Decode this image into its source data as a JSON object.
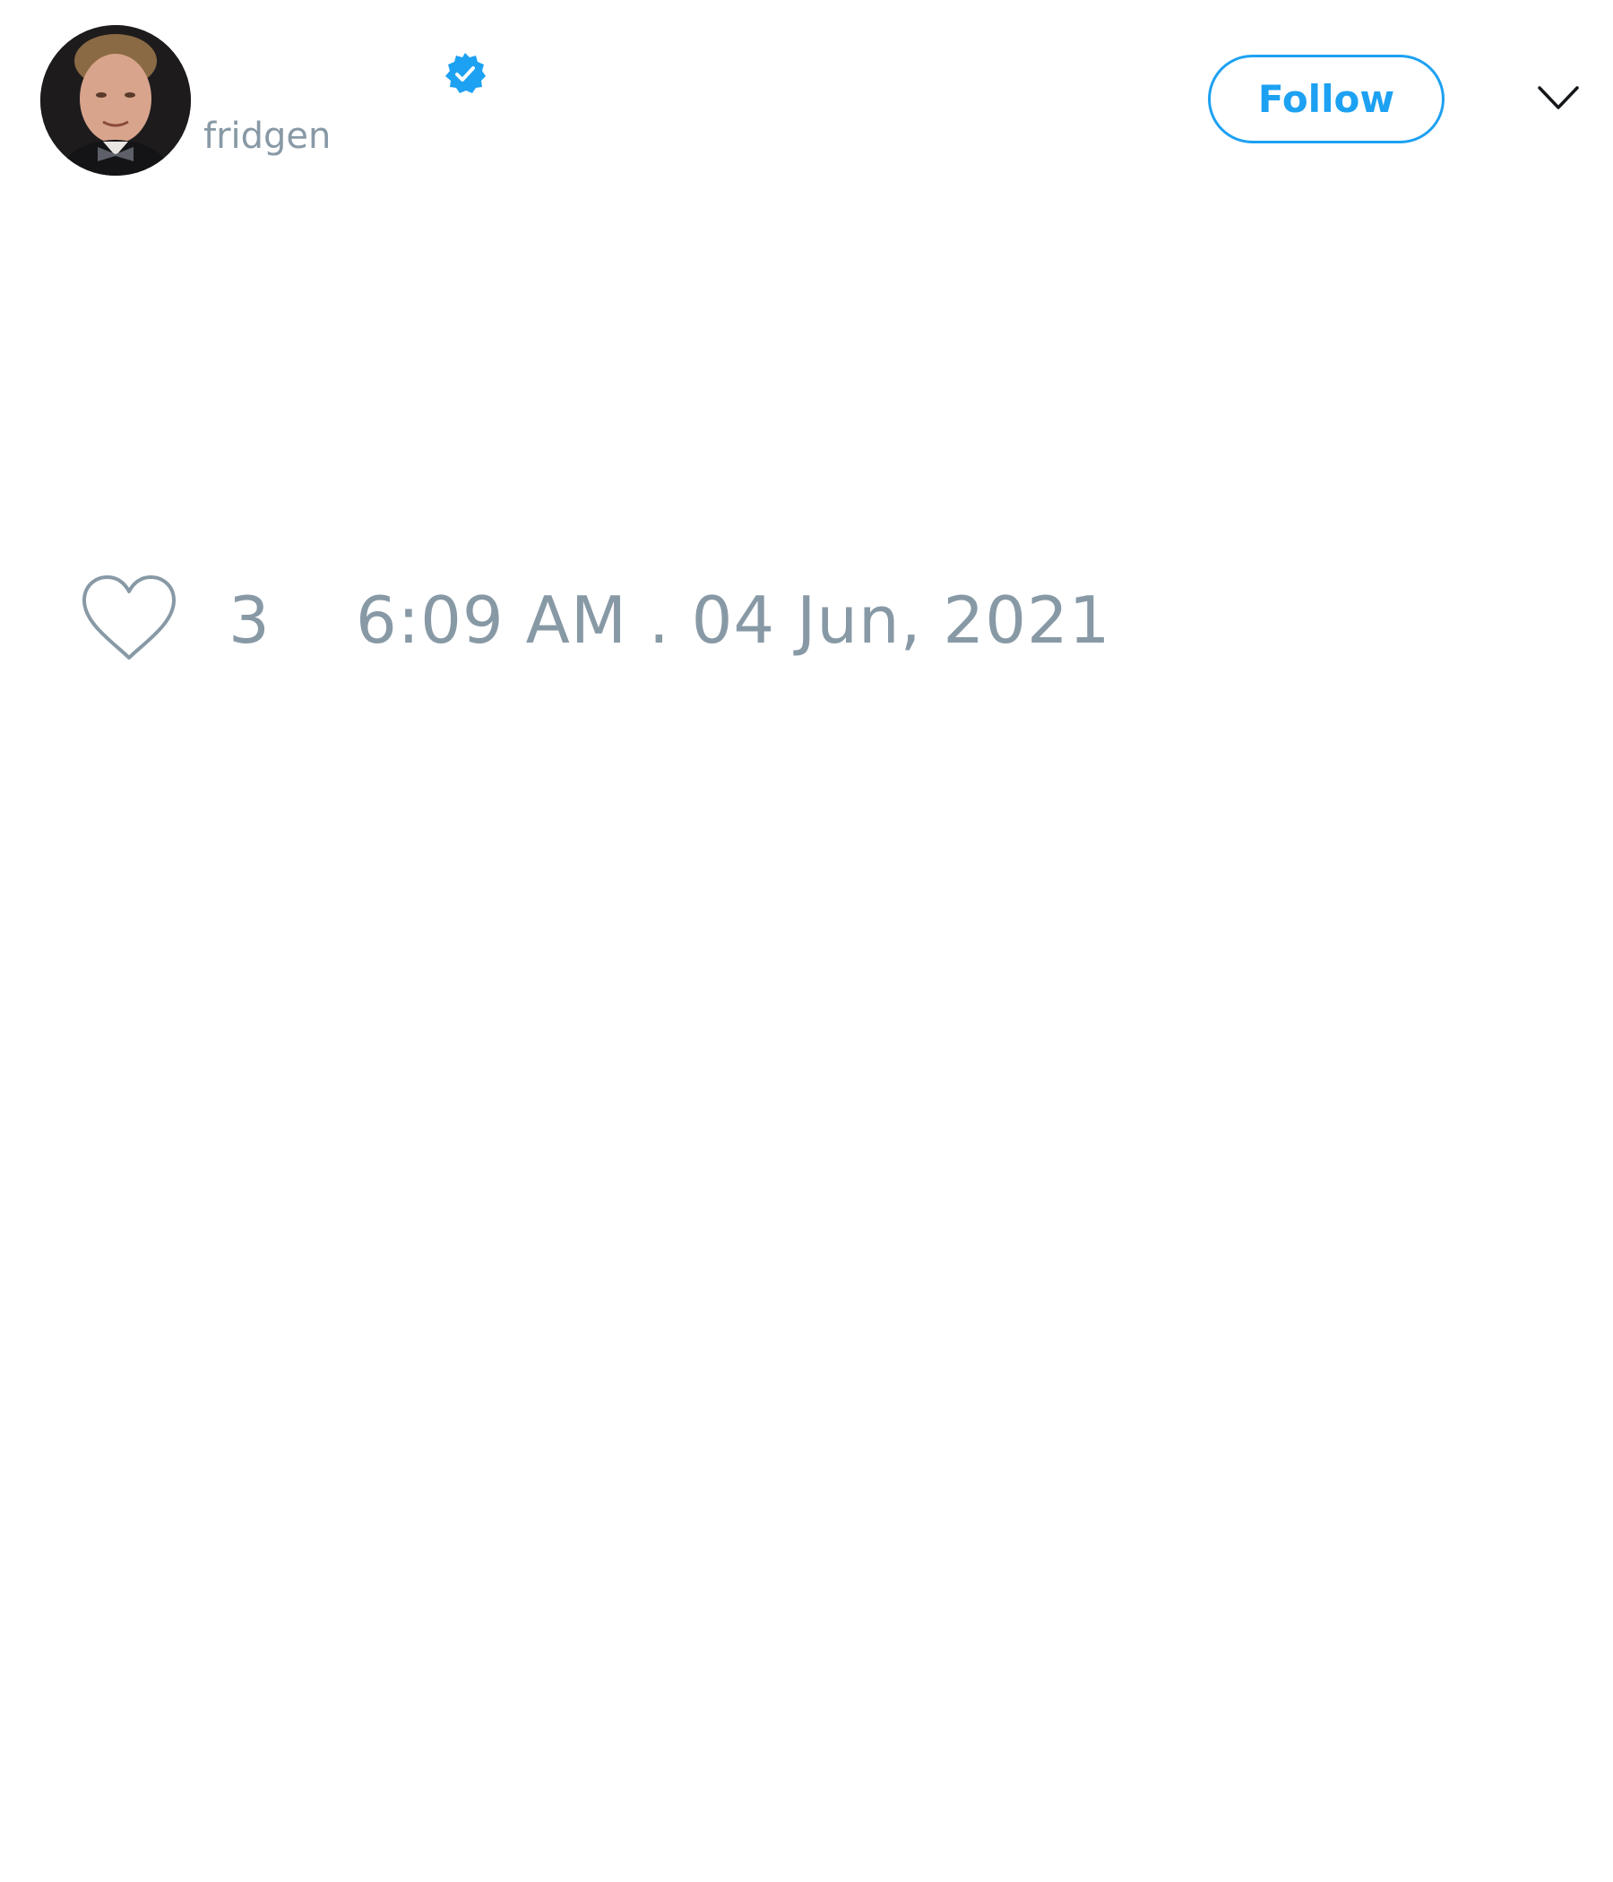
{
  "tweet": {
    "author": {
      "handle": "fridgen",
      "verified": true,
      "avatar_icon": "profile-photo"
    },
    "follow_label": "Follow",
    "menu_icon": "chevron-down-icon",
    "like_icon": "heart-outline-icon",
    "like_count": "3",
    "timestamp": "6:09 AM . 04 Jun, 2021"
  },
  "colors": {
    "accent": "#1da1f2",
    "muted_text": "#8899a6",
    "icon_stroke": "#8899a6",
    "chevron": "#14171a",
    "background": "#ffffff"
  }
}
